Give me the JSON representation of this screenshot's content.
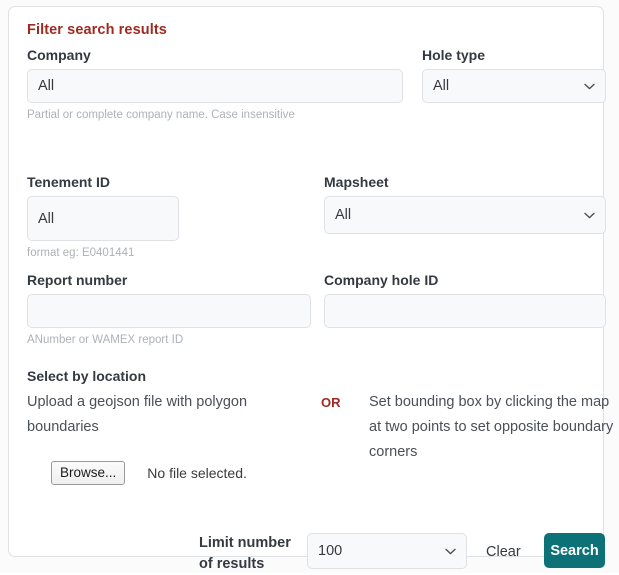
{
  "card": {
    "title": "Filter search results"
  },
  "fields": {
    "company": {
      "label": "Company",
      "value": "All",
      "placeholder": "All",
      "help": "Partial or complete company name. Case insensitive"
    },
    "hole_type": {
      "label": "Hole type",
      "value": "All",
      "options": [
        "All"
      ]
    },
    "tenement_id": {
      "label": "Tenement ID",
      "value": "All",
      "placeholder": "All",
      "help": "format eg: E0401441"
    },
    "mapsheet": {
      "label": "Mapsheet",
      "value": "All",
      "options": [
        "All"
      ]
    },
    "report_number": {
      "label": "Report number",
      "value": "",
      "placeholder": "",
      "help": "ANumber or WAMEX report ID"
    },
    "company_hole_id": {
      "label": "Company hole ID",
      "value": "",
      "placeholder": ""
    }
  },
  "location": {
    "section_label": "Select by location",
    "upload_text": "Upload a geojson file with polygon boundaries",
    "or_label": "OR",
    "bbox_text": "Set bounding box by clicking the map at two points to set opposite boundary corners",
    "browse_label": "Browse...",
    "file_status": "No file selected."
  },
  "footer": {
    "limit_label": "Limit number of results",
    "limit_value": "100",
    "limit_options": [
      "100"
    ],
    "clear_label": "Clear",
    "search_label": "Search"
  },
  "colors": {
    "accent_red": "#9e2a22",
    "search_teal": "#0c7277",
    "label_dark": "#343a40",
    "help_gray": "#adb2b8",
    "border_gray": "#dfe1e5",
    "input_bg": "#f8f9fb"
  },
  "icons": {
    "chevron": "chevron-down-icon"
  }
}
